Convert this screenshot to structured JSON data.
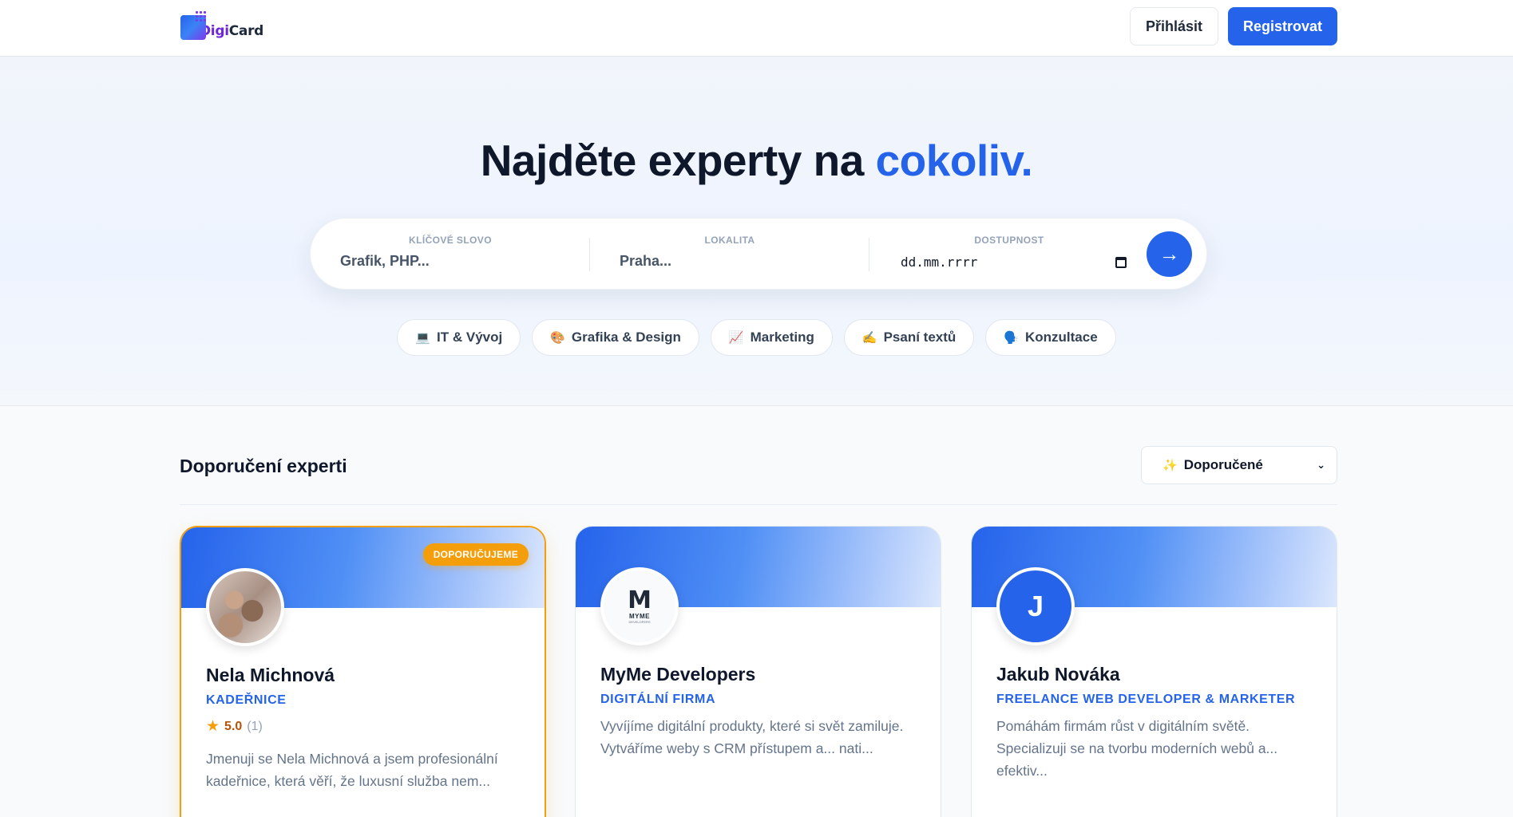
{
  "header": {
    "logo_part1": "Digi",
    "logo_part2": "Card",
    "login_label": "Přihlásit",
    "register_label": "Registrovat"
  },
  "hero": {
    "title_main": "Najděte experty na ",
    "title_accent": "cokoliv.",
    "search": {
      "keyword_label": "KLÍČOVÉ SLOVO",
      "keyword_placeholder": "Grafik, PHP...",
      "location_label": "LOKALITA",
      "location_placeholder": "Praha...",
      "availability_label": "DOSTUPNOST",
      "availability_value": "dd.mm.rrrr",
      "submit_icon": "→"
    },
    "categories": [
      {
        "icon": "💻",
        "label": "IT & Vývoj"
      },
      {
        "icon": "🎨",
        "label": "Grafika & Design"
      },
      {
        "icon": "📈",
        "label": "Marketing"
      },
      {
        "icon": "✍️",
        "label": "Psaní textů"
      },
      {
        "icon": "🗣️",
        "label": "Konzultace"
      }
    ]
  },
  "section": {
    "title": "Doporučení experti",
    "sort_icon": "✨",
    "sort_value": "Doporučené",
    "chevron": "⌄"
  },
  "cards": [
    {
      "featured": true,
      "badge": "DOPORUČUJEME",
      "name": "Nela Michnová",
      "role": "KADEŘNICE",
      "rating_score": "5.0",
      "rating_count": "(1)",
      "description": "Jmenuji se Nela Michnová a jsem profesionální kadeřnice, která věří, že luxusní služba nem..."
    },
    {
      "featured": false,
      "avatar_mark": "M",
      "avatar_text": "MYME",
      "avatar_subtext": "DEVELOPERS",
      "name": "MyMe Developers",
      "role": "DIGITÁLNÍ FIRMA",
      "description": "Vyvíjíme digitální produkty, které si svět zamiluje. Vytváříme weby s CRM přístupem a... nati..."
    },
    {
      "featured": false,
      "avatar_letter": "J",
      "name": "Jakub Nováka",
      "role": "FREELANCE WEB DEVELOPER & MARKETER",
      "description": "Pomáhám firmám růst v digitálním světě. Specializuji se na tvorbu moderních webů a... efektiv..."
    }
  ]
}
